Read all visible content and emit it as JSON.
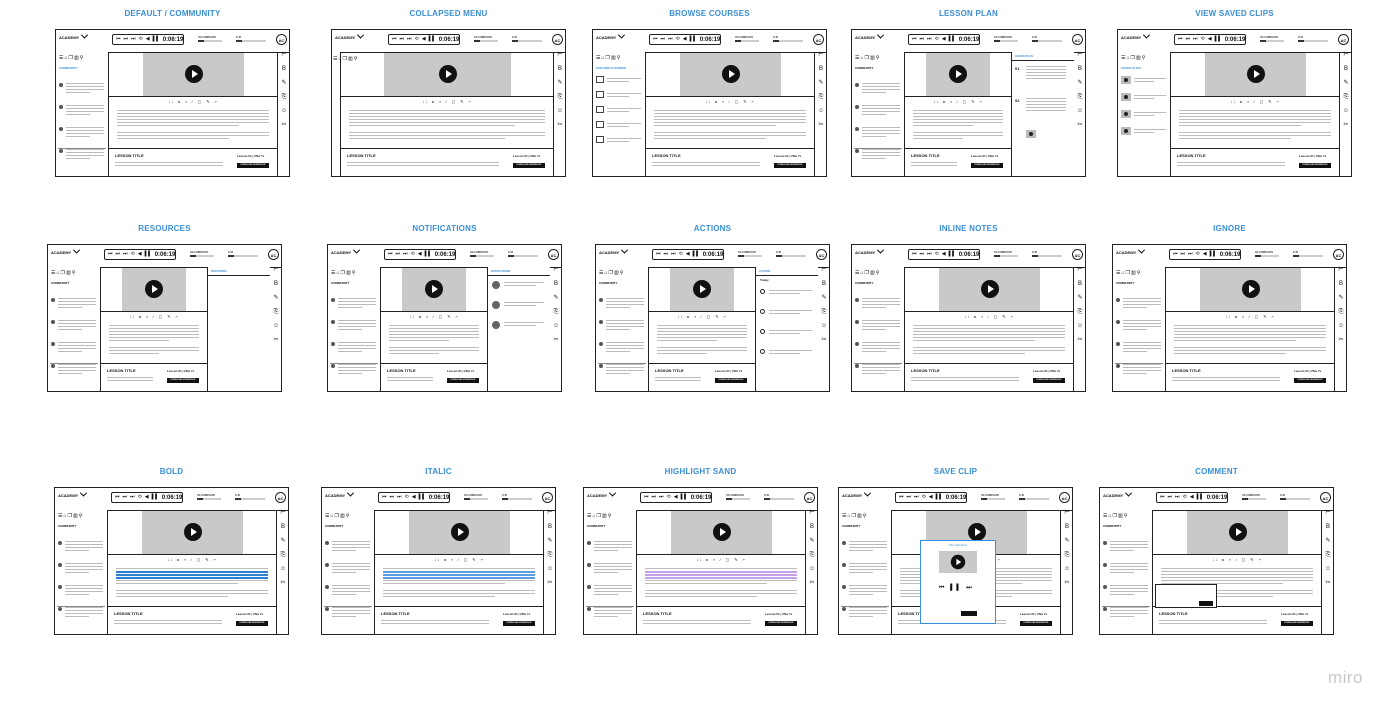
{
  "frames": [
    {
      "title": "DEFAULT / COMMUNITY",
      "variant": "community"
    },
    {
      "title": "COLLAPSED MENU",
      "variant": "collapsed"
    },
    {
      "title": "BROWSE COURSES",
      "variant": "browse"
    },
    {
      "title": "LESSON PLAN",
      "variant": "lessonplan"
    },
    {
      "title": "VIEW SAVED CLIPS",
      "variant": "savedclips"
    },
    {
      "title": "RESOURCES",
      "variant": "resources"
    },
    {
      "title": "NOTIFICATIONS",
      "variant": "notifications"
    },
    {
      "title": "ACTIONS",
      "variant": "actions"
    },
    {
      "title": "INLINE NOTES",
      "variant": "inlinenotes"
    },
    {
      "title": "IGNORE",
      "variant": "ignore"
    },
    {
      "title": "BOLD",
      "variant": "bold"
    },
    {
      "title": "ITALIC",
      "variant": "italic"
    },
    {
      "title": "HIGHLIGHT SAND",
      "variant": "highlight"
    },
    {
      "title": "SAVE CLIP",
      "variant": "saveclip"
    },
    {
      "title": "COMMENT",
      "variant": "comment"
    }
  ],
  "wireframe": {
    "brand": "ACADEMY",
    "time": "0:06:19",
    "avatar": "AC",
    "progress_label_1": "4% COMPLETE",
    "progress_1": 0.25,
    "progress_label_2": "3:45",
    "progress_2": 0.2,
    "community_title": "COMMUNITY",
    "lesson_title": "LESSON TITLE",
    "lesson_meta": "Lesson 01 | 25m 7s",
    "download_label": "DOWNLOAD WORKBOOK",
    "panel_titles": {
      "browse": "EXPLORE COURSES",
      "lessonplan": "LESSON PLAN",
      "savedclips": "SAVED CLIPS",
      "resources": "RESOURCES",
      "notifications": "NOTIFICATIONS",
      "actions": "ACTIONS"
    },
    "actions_today": "Today",
    "lesson_plan_steps": [
      "01",
      "02"
    ],
    "clip_popup_title": "Clip Selection",
    "icons": [
      "menu-icon",
      "community-icon",
      "book-icon",
      "library-icon",
      "search-icon"
    ],
    "tools": [
      "ignore-icon",
      "bold-icon",
      "highlight-icon",
      "note-icon",
      "comment-icon",
      "clip-icon"
    ]
  },
  "watermark": "miro"
}
